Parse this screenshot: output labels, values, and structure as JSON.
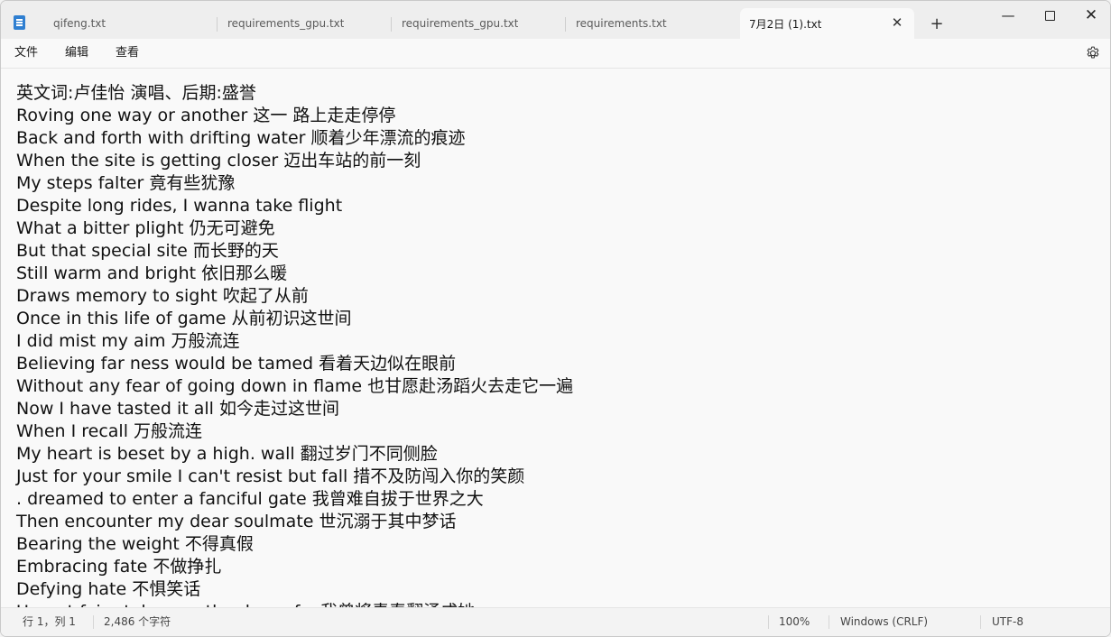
{
  "tabs": [
    {
      "label": "qifeng.txt"
    },
    {
      "label": "requirements_gpu.txt"
    },
    {
      "label": "requirements_gpu.txt"
    },
    {
      "label": "requirements.txt"
    },
    {
      "label": "7月2日 (1).txt"
    }
  ],
  "tab_close_glyph": "✕",
  "new_tab_glyph": "+",
  "window_controls": {
    "minimize": "—",
    "close": "✕"
  },
  "menu": {
    "file": "文件",
    "edit": "编辑",
    "view": "查看"
  },
  "lines": [
    "英文词:卢佳怡 演唱、后期:盛誉",
    "Roving one way or another 这一 路上走走停停",
    "Back and forth with drifting water 顺着少年漂流的痕迹",
    "When the site is getting closer 迈出车站的前一刻",
    "My steps falter 竟有些犹豫",
    "Despite long rides, I wanna take flight",
    "What a bitter plight 仍无可避免",
    "But that special site 而长野的天",
    "Still warm and bright 依旧那么暖",
    "Draws memory to sight 吹起了从前",
    "Once in this life of game 从前初识这世间",
    "I did mist my aim 万般流连",
    "Believing far ness would be tamed 看着天边似在眼前",
    "Without any fear of going down in flame 也甘愿赴汤蹈火去走它一遍",
    "Now I have tasted it all 如今走过这世间",
    "When I recall 万般流连",
    "My heart is beset by a high. wall 翻过岁门不同侧脸",
    "Just for your smile I can't resist but fall 措不及防闯入你的笑颜",
    ". dreamed to enter a fanciful gate 我曾难自拔于世界之大",
    "Then encounter my dear soulmate 世沉溺于其中梦话",
    "Bearing the weight 不得真假",
    "Embracing fate 不做挣扎",
    "Defying hate 不惧笑话",
    "Uproot fairy-tale ... ... the door of... 我曾将青春翻涌成她"
  ],
  "status": {
    "position": "行 1，列 1",
    "chars": "2,486 个字符",
    "zoom": "100%",
    "eol": "Windows (CRLF)",
    "encoding": "UTF-8"
  }
}
